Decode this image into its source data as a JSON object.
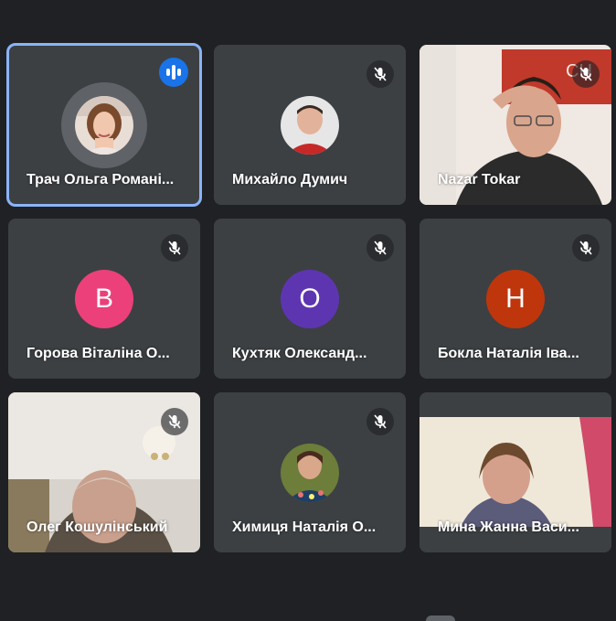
{
  "participants": [
    {
      "name": "Трач Ольга Романі...",
      "speaking": true
    },
    {
      "name": "Михайло Думич",
      "muted": true
    },
    {
      "name": "Nazar Tokar",
      "muted": true
    },
    {
      "name": "Горова Віталіна О...",
      "muted": true,
      "initial": "В",
      "color": "#ec407a"
    },
    {
      "name": "Кухтяк Олександ...",
      "muted": true,
      "initial": "О",
      "color": "#5e35b1"
    },
    {
      "name": "Бокла Наталія Іва...",
      "muted": true,
      "initial": "Н",
      "color": "#bf360c"
    },
    {
      "name": "Олег Кошулінський",
      "muted": true
    },
    {
      "name": "Химиця Наталія О...",
      "muted": true
    },
    {
      "name": "Мина Жанна Васи...",
      "muted": false
    }
  ],
  "colors": {
    "background": "#202124",
    "tile": "#3c4043",
    "active_border": "#8ab4f8",
    "speaking_badge": "#1a73e8"
  },
  "icons": {
    "muted": "mic-off-icon",
    "speaking": "audio-level-icon"
  }
}
